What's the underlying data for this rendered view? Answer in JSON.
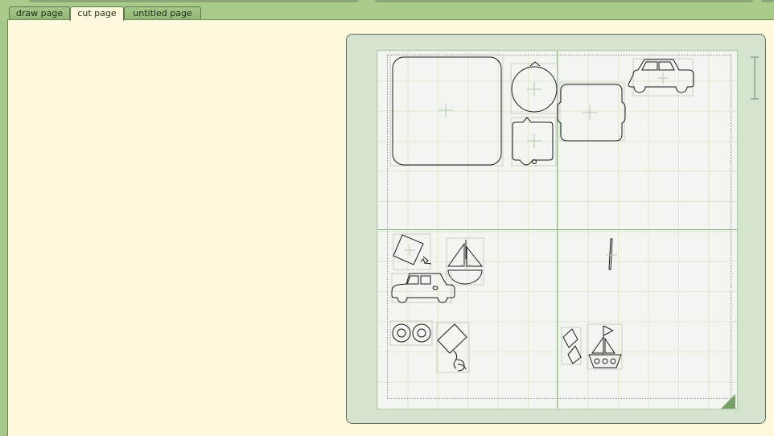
{
  "tabs": [
    {
      "label": "draw page",
      "active": false
    },
    {
      "label": "cut page",
      "active": true
    },
    {
      "label": "untitled page",
      "active": false
    }
  ],
  "colors": {
    "frame_green": "#a9cc8c",
    "page_cream": "#fef8dc",
    "mat_green": "#d3e3cd",
    "mat_surface": "#f3f5f1",
    "grid_line": "#dce8cf",
    "accent_green": "#7aa06a"
  },
  "mat": {
    "icons": {
      "left_arrow": "triangle-left-icon",
      "corner": "corner-triangle-icon",
      "scale": "vertical-resize-icon"
    },
    "shapes": [
      "rounded-square-shape",
      "ornament-circle-shape",
      "tag-shape",
      "scalloped-label-shape",
      "car-shape",
      "kite-shape",
      "sailboat-shape",
      "car-shape",
      "wheels-shape",
      "kite-with-tail-shape",
      "line-shape",
      "diamonds-shape",
      "boat-shape"
    ]
  }
}
